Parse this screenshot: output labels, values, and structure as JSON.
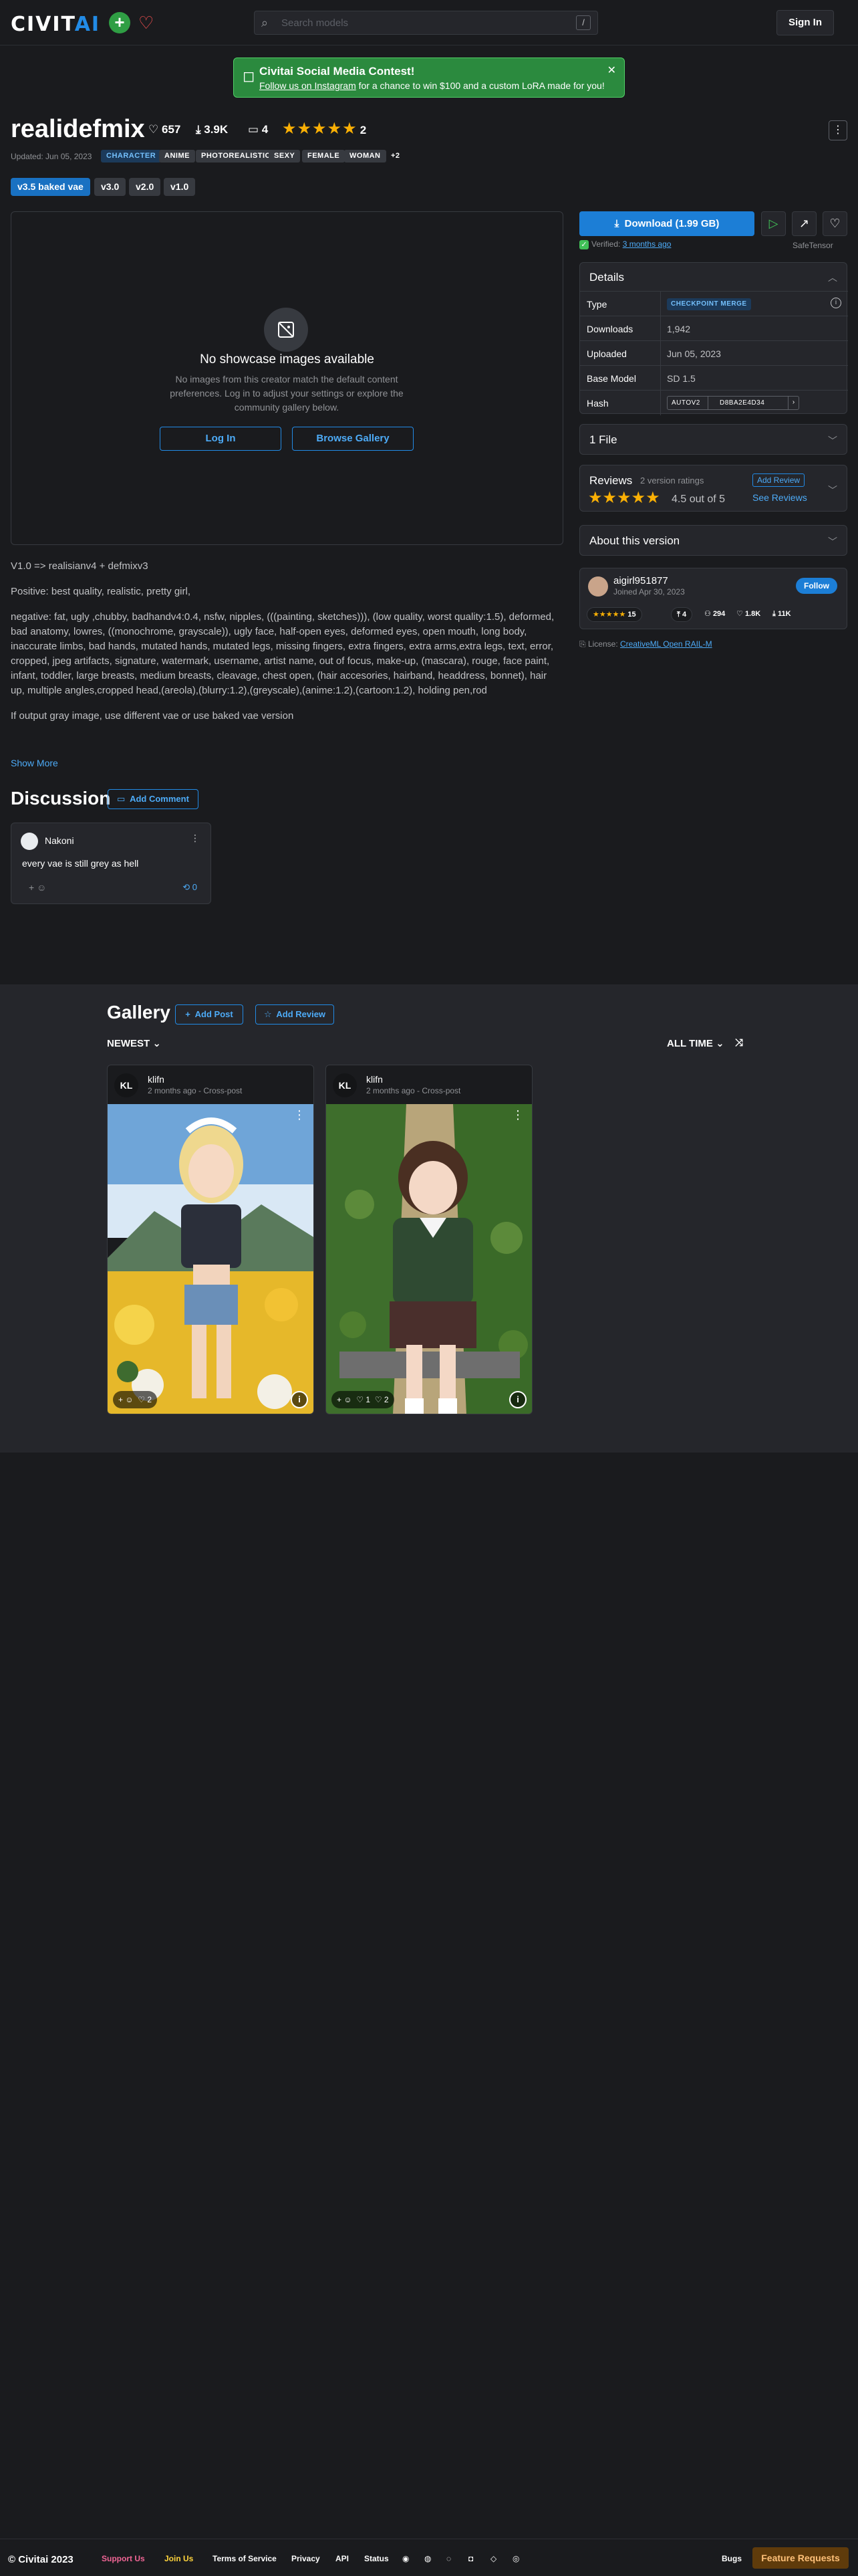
{
  "header": {
    "logo_main": "CIVIT",
    "logo_accent": "AI",
    "search_placeholder": "Search models",
    "search_shortcut": "/",
    "signin_label": "Sign In"
  },
  "banner": {
    "title": "Civitai Social Media Contest!",
    "link_text": "Follow us on Instagram",
    "text": " for a chance to win $100 and a custom LoRA made for you!"
  },
  "model": {
    "title": "realidefmix",
    "likes": "657",
    "downloads": "3.9K",
    "comments": "4",
    "rating_count": "2",
    "updated": "Updated: Jun 05, 2023",
    "tags": [
      "CHARACTER",
      "ANIME",
      "PHOTOREALISTIC",
      "SEXY",
      "FEMALE",
      "WOMAN",
      "+2"
    ],
    "versions": [
      "v3.5 baked vae",
      "v3.0",
      "v2.0",
      "v1.0"
    ]
  },
  "showcase": {
    "title": "No showcase images available",
    "text": "No images from this creator match the default content preferences. Log in to adjust your settings or explore the community gallery below.",
    "login_label": "Log In",
    "browse_label": "Browse Gallery"
  },
  "download": {
    "label": "Download (1.99 GB)",
    "verified": "Verified: ",
    "verified_when": "3 months ago",
    "safetensor": "SafeTensor"
  },
  "details": {
    "title": "Details",
    "rows": [
      {
        "k": "Type",
        "v": "CHECKPOINT MERGE"
      },
      {
        "k": "Downloads",
        "v": "1,942"
      },
      {
        "k": "Uploaded",
        "v": "Jun 05, 2023"
      },
      {
        "k": "Base Model",
        "v": "SD 1.5"
      },
      {
        "k": "Hash",
        "v": "D8BA2E4D34"
      }
    ],
    "hash_type": "AUTOV2"
  },
  "files": {
    "title": "1 File"
  },
  "reviews": {
    "title": "Reviews",
    "count": "2 version ratings",
    "score": "4.5 out of 5",
    "add_label": "Add Review",
    "see_label": "See Reviews"
  },
  "about": {
    "title": "About this version"
  },
  "creator": {
    "name": "aigirl951877",
    "joined": "Joined Apr 30, 2023",
    "follow_label": "Follow",
    "rating": "15",
    "uploads": "4",
    "followers": "294",
    "likes": "1.8K",
    "downloads": "11K"
  },
  "license": {
    "prefix": "License: ",
    "name": "CreativeML Open RAIL-M"
  },
  "description": {
    "p1": "V1.0 => realisianv4 + defmixv3",
    "p2": "Positive: best quality, realistic, pretty girl,",
    "p3": "negative: fat, ugly ,chubby, badhandv4:0.4, nsfw, nipples, (((painting, sketches))), (low quality, worst quality:1.5), deformed, bad anatomy, lowres, ((monochrome, grayscale)), ugly face, half-open eyes, deformed eyes, open mouth, long body, inaccurate limbs, bad hands, mutated hands, mutated legs, missing fingers, extra fingers, extra arms,extra legs, text, error, cropped, jpeg artifacts, signature, watermark, username, artist name, out of focus, make-up, (mascara), rouge, face paint, infant, toddler, large breasts, medium breasts, cleavage, chest open, (hair accesories, hairband, headdress, bonnet), hair up, multiple angles,cropped head,(areola),(blurry:1.2),(greyscale),(anime:1.2),(cartoon:1.2), holding pen,rod",
    "p4": "If output gray image, use different vae or use baked vae version",
    "show_more": "Show More"
  },
  "discussion": {
    "title": "Discussion",
    "add_label": "Add Comment",
    "comment": {
      "user": "Nakoni",
      "text": "every vae is still grey as hell",
      "replies": "0"
    }
  },
  "gallery": {
    "title": "Gallery",
    "add_post": "Add Post",
    "add_review": "Add Review",
    "sort": "NEWEST",
    "period": "ALL TIME",
    "cards": [
      {
        "initials": "KL",
        "user": "klifn",
        "meta": "2 months ago - Cross-post",
        "reactions": "2"
      },
      {
        "initials": "KL",
        "user": "klifn",
        "meta": "2 months ago - Cross-post",
        "reactions1": "1",
        "reactions2": "2"
      }
    ]
  },
  "footer": {
    "copyright": "© Civitai 2023",
    "links": [
      "Support Us",
      "Join Us",
      "Terms of Service",
      "Privacy",
      "API",
      "Status"
    ],
    "bugs": "Bugs",
    "feature": "Feature Requests"
  },
  "colors": {
    "accent": "#228be6",
    "star": "#fab005",
    "banner": "#2b8a3e"
  }
}
